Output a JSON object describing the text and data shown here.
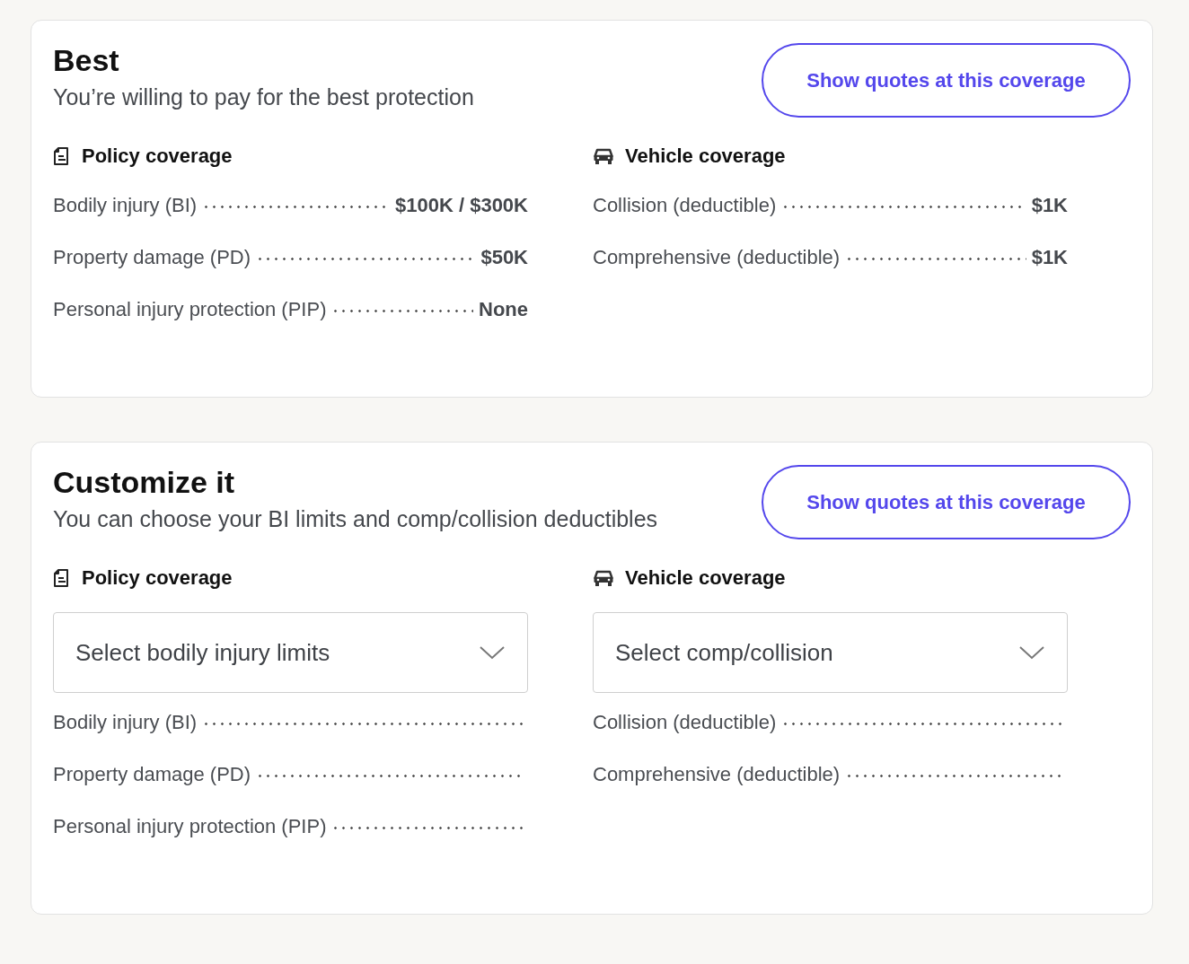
{
  "plans": [
    {
      "title": "Best",
      "subtitle": "You’re willing to pay for the best protection",
      "button": "Show quotes at this coverage",
      "columns": [
        {
          "kind": "policy",
          "heading": "Policy coverage",
          "rows": [
            {
              "label": "Bodily injury (BI)",
              "value": "$100K / $300K"
            },
            {
              "label": "Property damage (PD)",
              "value": "$50K"
            },
            {
              "label": "Personal injury protection (PIP)",
              "value": "None"
            }
          ]
        },
        {
          "kind": "vehicle",
          "heading": "Vehicle coverage",
          "rows": [
            {
              "label": "Collision (deductible)",
              "value": "$1K"
            },
            {
              "label": "Comprehensive (deductible)",
              "value": "$1K"
            }
          ]
        }
      ]
    },
    {
      "title": "Customize it",
      "subtitle": "You can choose your BI limits and comp/collision deductibles",
      "button": "Show quotes at this coverage",
      "columns": [
        {
          "kind": "policy",
          "heading": "Policy coverage",
          "dropdown": "Select bodily injury limits",
          "rows": [
            {
              "label": "Bodily injury (BI)"
            },
            {
              "label": "Property damage (PD)"
            },
            {
              "label": "Personal injury protection (PIP)"
            }
          ]
        },
        {
          "kind": "vehicle",
          "heading": "Vehicle coverage",
          "dropdown": "Select comp/collision",
          "rows": [
            {
              "label": "Collision (deductible)"
            },
            {
              "label": "Comprehensive (deductible)"
            }
          ]
        }
      ]
    }
  ]
}
